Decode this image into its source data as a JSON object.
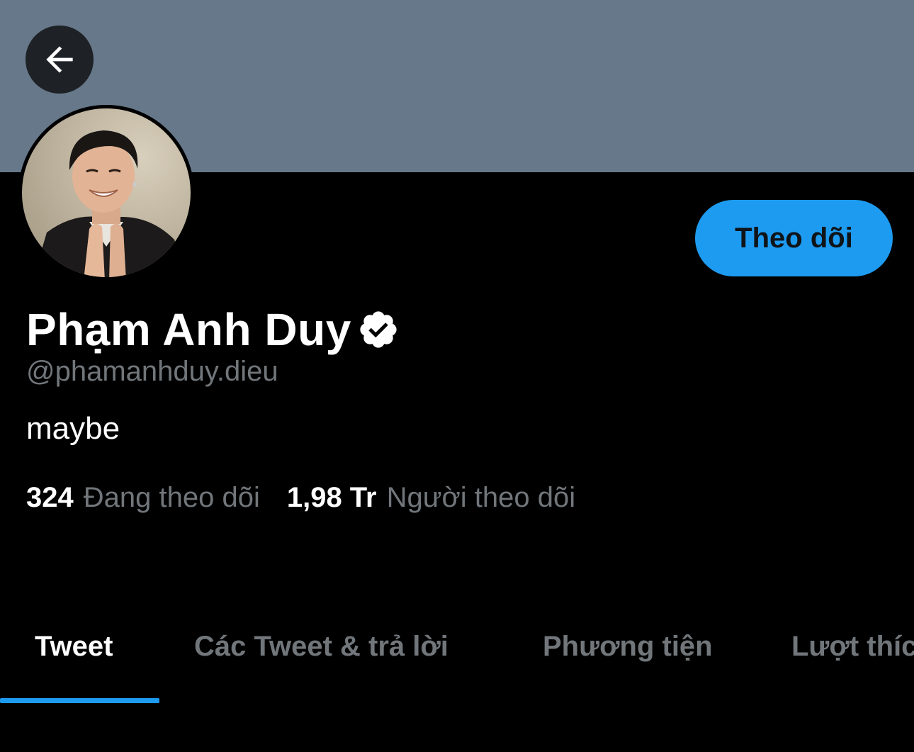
{
  "profile": {
    "display_name": "Phạm Anh Duy",
    "handle": "@phamanhduy.dieu",
    "bio": "maybe",
    "verified": true
  },
  "actions": {
    "follow_label": "Theo dõi"
  },
  "stats": {
    "following_count": "324",
    "following_label": "Đang theo dõi",
    "followers_count": "1,98 Tr",
    "followers_label": "Người theo dõi"
  },
  "tabs": [
    {
      "label": "Tweet",
      "active": true
    },
    {
      "label": "Các Tweet & trả lời",
      "active": false
    },
    {
      "label": "Phương tiện",
      "active": false
    },
    {
      "label": "Lượt thích",
      "active": false
    }
  ],
  "colors": {
    "banner": "#66788a",
    "accent": "#1d9bf0",
    "secondary_text": "#71767b"
  },
  "icons": {
    "back": "arrow-left-icon",
    "verified": "verified-badge-icon"
  }
}
